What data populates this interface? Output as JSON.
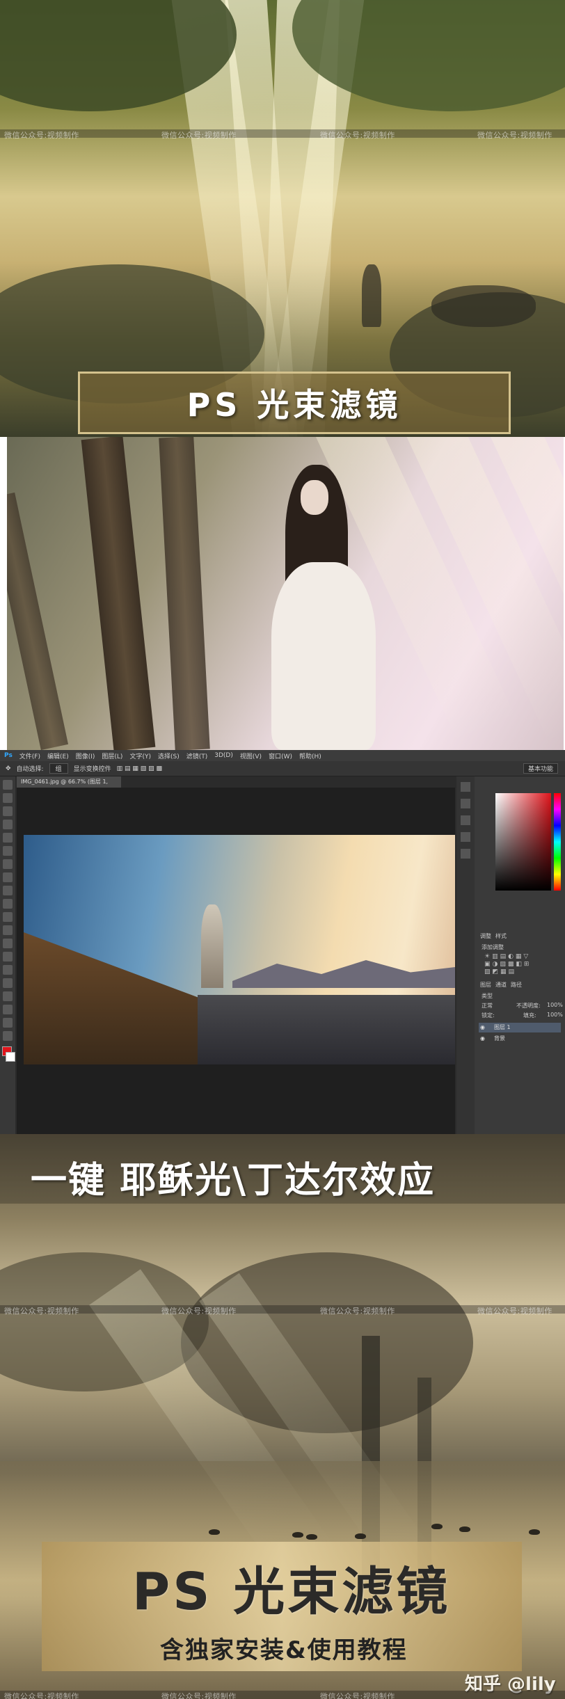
{
  "watermark": {
    "left": "微信公众号:视频制作",
    "right": "微信公众号:视频制作"
  },
  "panel1": {
    "title": "PS  光束滤镜"
  },
  "photoshop": {
    "menu": [
      "文件(F)",
      "编辑(E)",
      "图像(I)",
      "图层(L)",
      "文字(Y)",
      "选择(S)",
      "滤镜(T)",
      "3D(D)",
      "视图(V)",
      "窗口(W)",
      "帮助(H)"
    ],
    "options": [
      "自动选择:",
      "组",
      "显示变换控件"
    ],
    "workspace": "基本功能",
    "doc_tab": "IMG_0461.jpg @ 66.7% (图层 1, RGB/8) *",
    "panel_tabs": {
      "adjust": "调整",
      "style": "样式",
      "add_adjust": "添加调整",
      "layers": "图层",
      "channels": "通道",
      "paths": "路径"
    },
    "layer_kind": "类型",
    "blend_mode": "正常",
    "opacity_label": "不透明度:",
    "opacity_value": "100%",
    "lock_label": "锁定:",
    "fill_label": "填充:",
    "fill_value": "100%",
    "layers": [
      {
        "name": "图层 1"
      },
      {
        "name": "背景"
      }
    ],
    "colors": {
      "foreground": "#e0141b",
      "background": "#ffffff"
    }
  },
  "panel4": {
    "banner": "一键 耶稣光\\丁达尔效应",
    "title": "PS  光束滤镜",
    "subtitle": "含独家安装&使用教程",
    "zhihu": "知乎 @lily"
  }
}
